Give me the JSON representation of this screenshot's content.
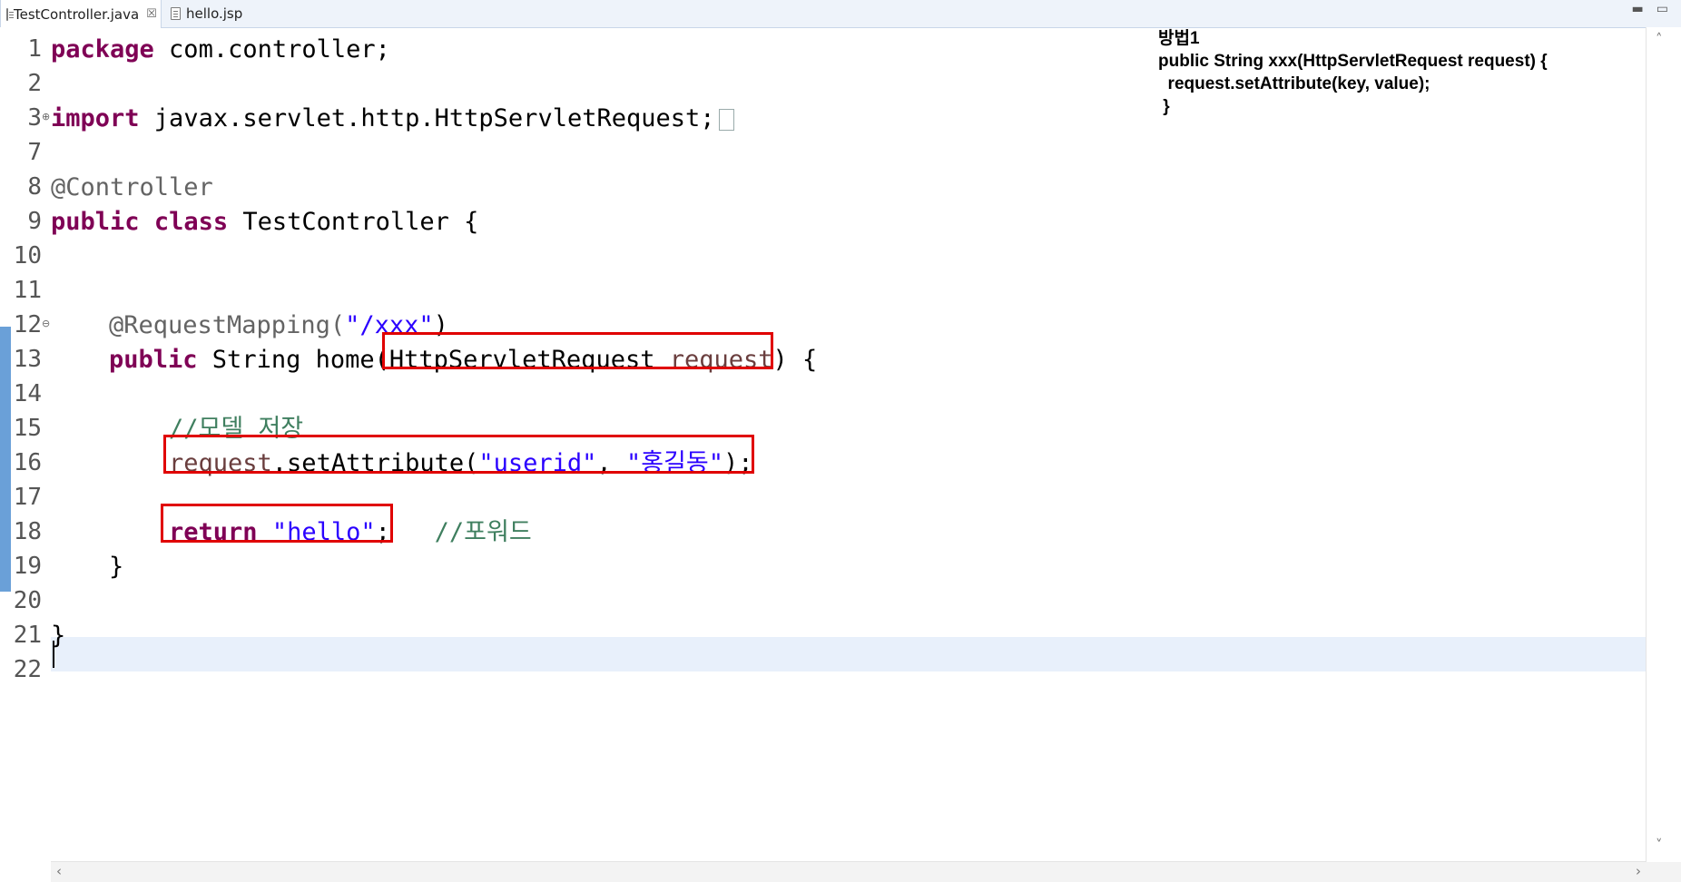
{
  "tabs": [
    {
      "label": "TestController.java",
      "close": "☒",
      "active": true
    },
    {
      "label": "hello.jsp",
      "active": false
    }
  ],
  "window_controls": {
    "minimize": "▬",
    "maximize": "▭"
  },
  "scroll_glyphs": {
    "up": "˄",
    "down": "˅",
    "left": "‹",
    "right": "›"
  },
  "line_numbers": [
    "1",
    "2",
    "3",
    "7",
    "8",
    "9",
    "10",
    "11",
    "12",
    "13",
    "14",
    "15",
    "16",
    "17",
    "18",
    "19",
    "20",
    "21",
    "22"
  ],
  "code": {
    "l1": {
      "kw": "package",
      "rest": " com.controller;"
    },
    "l3": {
      "kw": "import",
      "rest": " javax.servlet.http.HttpServletRequest;"
    },
    "l8": {
      "ann": "@Controller"
    },
    "l9": {
      "kw1": "public",
      "kw2": "class",
      "rest": " TestController {"
    },
    "l12": {
      "ann": "@RequestMapping(",
      "str": "\"/xxx\"",
      "rest": ")"
    },
    "l13": {
      "kw": "public",
      "mid": " String home(HttpServletRequest ",
      "var": "request",
      "rest": ") {"
    },
    "l15": {
      "cmt": "//모델 저장"
    },
    "l16": {
      "var": "request",
      "mid": ".setAttribute(",
      "str1": "\"userid\"",
      "sep": ", ",
      "str2": "\"홍길동\"",
      "rest": ");"
    },
    "l18": {
      "kw": "return",
      "sp": " ",
      "str": "\"hello\"",
      "rest": ";",
      "gap": "   ",
      "cmt": "//포워드"
    },
    "l19": {
      "text": "}"
    },
    "l21": {
      "text": "}"
    }
  },
  "note": {
    "title": "방법1",
    "line1": "public String xxx(HttpServletRequest request) {",
    "line2": "  request.setAttribute(key, value);",
    "line3": " }"
  },
  "colors": {
    "highlight": "#e00000",
    "keyword": "#7f0055",
    "string": "#2a00ff",
    "comment": "#3f7f5f"
  }
}
